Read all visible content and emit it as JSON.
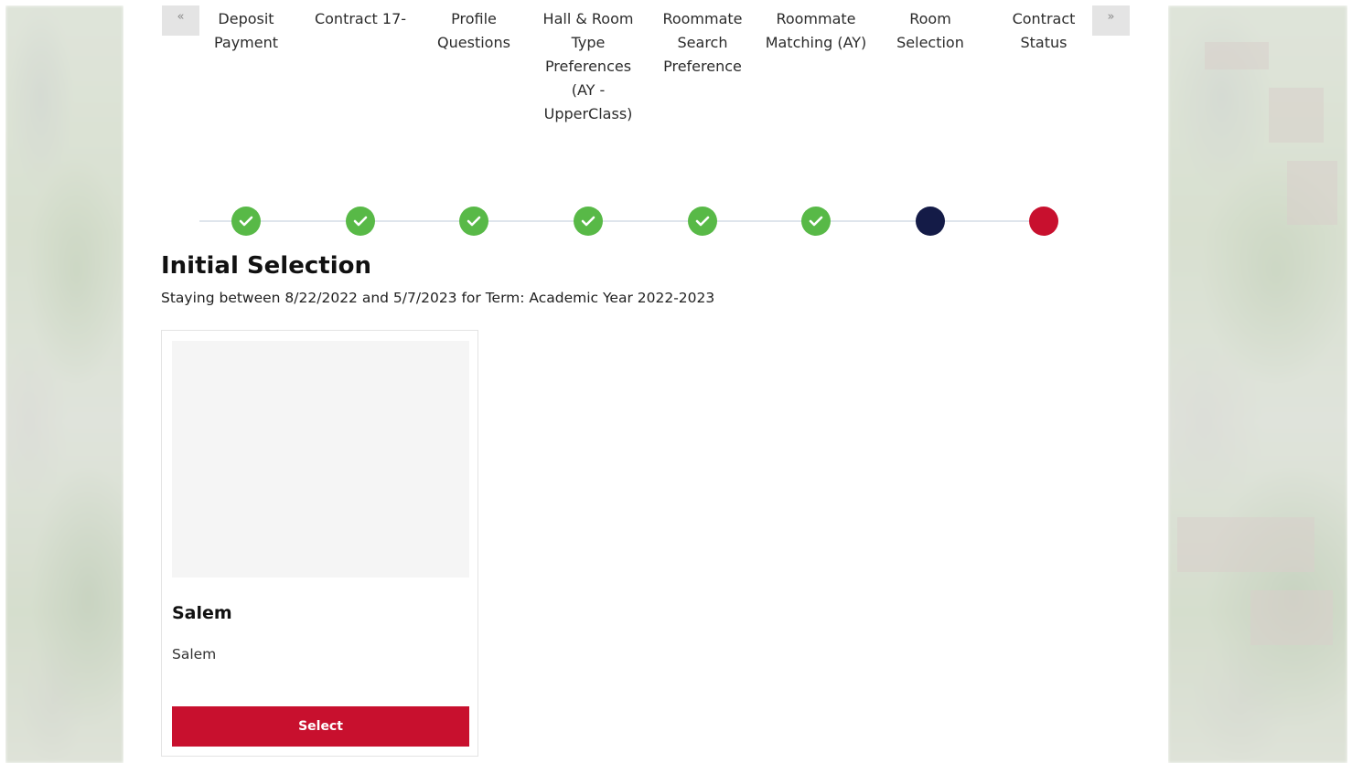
{
  "steps": {
    "prev_icon": "«",
    "next_icon": "»",
    "items": [
      {
        "label": "Deposit Payment",
        "status": "completed"
      },
      {
        "label": "Contract 17-",
        "status": "completed"
      },
      {
        "label": "Profile Questions",
        "status": "completed"
      },
      {
        "label": "Hall & Room Type Preferences (AY - UpperClass)",
        "status": "completed"
      },
      {
        "label": "Roommate Search Preference",
        "status": "completed"
      },
      {
        "label": "Roommate Matching (AY)",
        "status": "completed"
      },
      {
        "label": "Room Selection",
        "status": "current"
      },
      {
        "label": "Contract Status",
        "status": "upcoming"
      }
    ],
    "colors": {
      "completed": "#58b947",
      "current": "#141b47",
      "upcoming": "#c8102e"
    }
  },
  "page": {
    "title": "Initial Selection",
    "subtitle": "Staying between 8/22/2022 and 5/7/2023 for Term: Academic Year 2022-2023"
  },
  "hall_card": {
    "name": "Salem",
    "description": "Salem",
    "button_label": "Select",
    "button_color": "#c8102e"
  }
}
